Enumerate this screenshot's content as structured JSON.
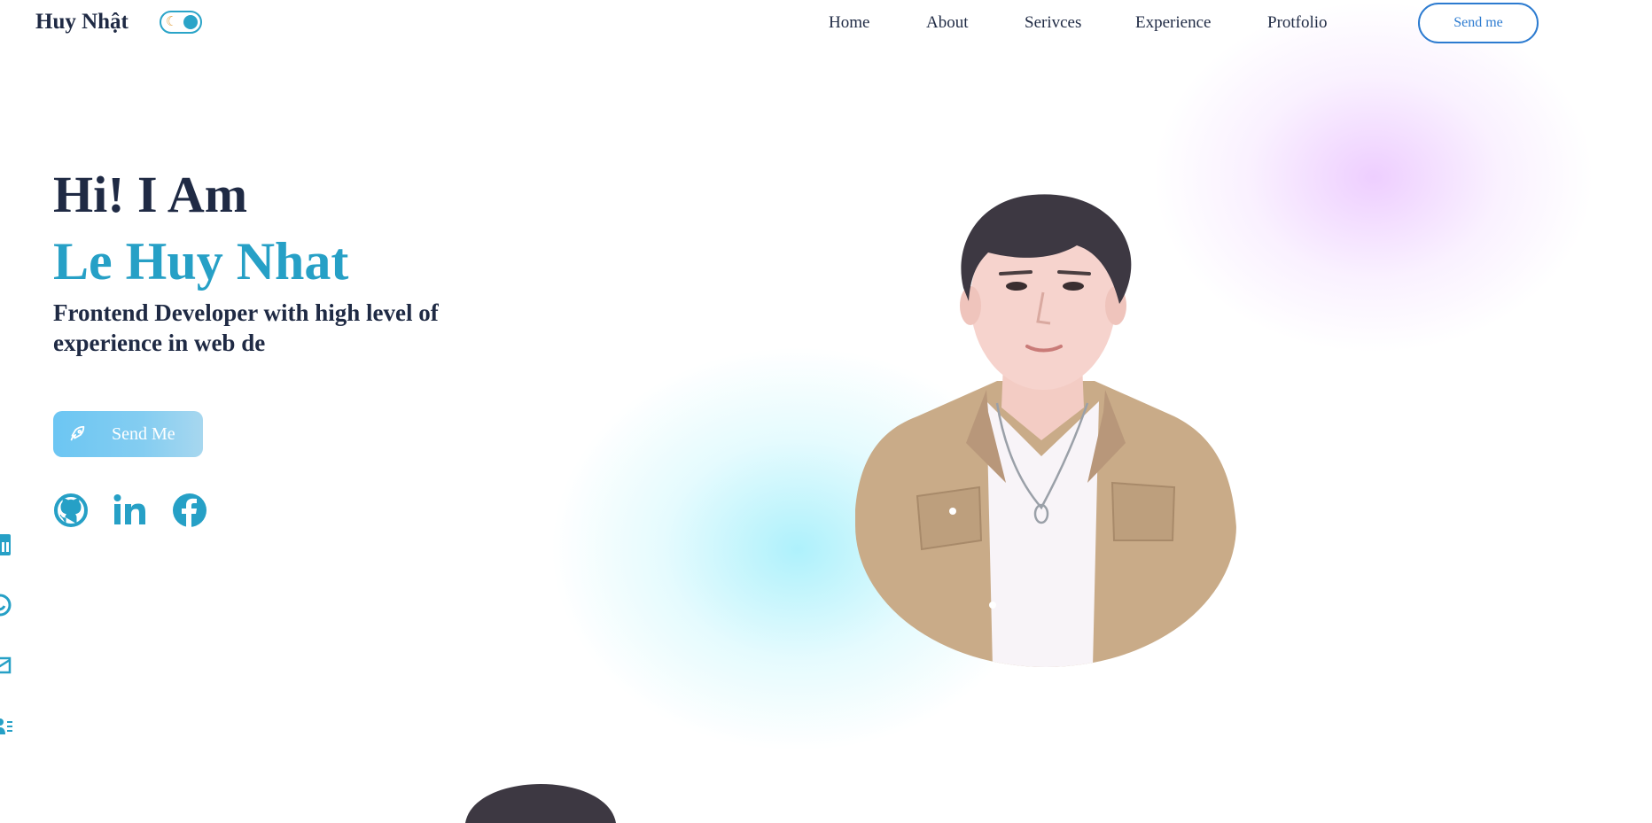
{
  "header": {
    "logo": "Huy Nhật",
    "nav": [
      "Home",
      "About",
      "Serivces",
      "Experience",
      "Protfolio"
    ],
    "send_button": "Send me"
  },
  "hero": {
    "greeting": "Hi! I Am",
    "name": "Le Huy Nhat",
    "tagline": "Frontend Developer with high level of experience in web de",
    "cta_label": "Send Me"
  },
  "social_icons": [
    "github-icon",
    "linkedin-icon",
    "facebook-icon"
  ],
  "side_icons": [
    "linkedin-icon",
    "github-icon",
    "mail-icon",
    "resume-icon"
  ],
  "colors": {
    "accent": "#26a0c6",
    "text_dark": "#1f2a44",
    "button_blue": "#2c7bd0",
    "glow_purple": "#e8beff",
    "glow_cyan": "#8cebfa"
  }
}
